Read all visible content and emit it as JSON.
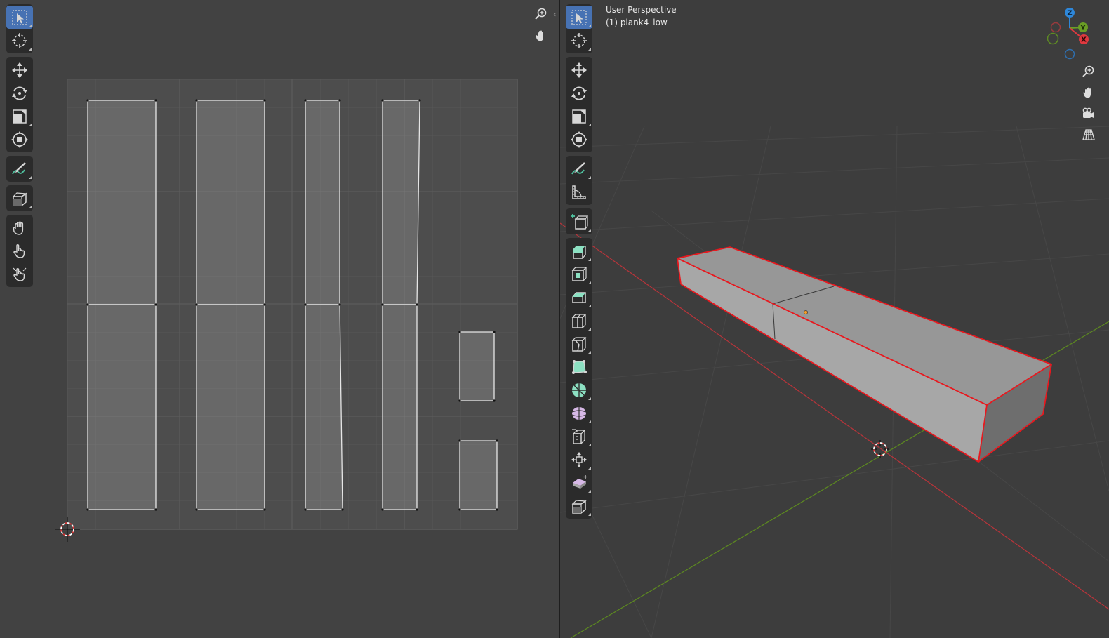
{
  "uv_editor": {
    "tools": [
      {
        "group": 1,
        "name": "select-box-tool",
        "icon": "cursor-select-icon",
        "active": true
      },
      {
        "group": 1,
        "name": "cursor-tool",
        "icon": "cursor-crosshair-icon",
        "active": false
      },
      {
        "group": 2,
        "name": "move-tool",
        "icon": "move-icon",
        "active": false
      },
      {
        "group": 2,
        "name": "rotate-tool",
        "icon": "rotate-icon",
        "active": false
      },
      {
        "group": 2,
        "name": "scale-tool",
        "icon": "scale-icon",
        "active": false
      },
      {
        "group": 2,
        "name": "transform-tool",
        "icon": "transform-icon",
        "active": false
      },
      {
        "group": 3,
        "name": "annotate-tool",
        "icon": "annotate-icon",
        "active": false
      },
      {
        "group": 4,
        "name": "rip-tool",
        "icon": "rip-region-icon",
        "active": false
      },
      {
        "group": 5,
        "name": "grab-tool",
        "icon": "grab-hand-icon",
        "active": false
      },
      {
        "group": 5,
        "name": "relax-tool",
        "icon": "relax-hand-icon",
        "active": false
      },
      {
        "group": 5,
        "name": "pinch-tool",
        "icon": "pinch-hand-icon",
        "active": false
      }
    ],
    "nav_icons": [
      "zoom-icon",
      "pan-hand-icon"
    ]
  },
  "viewport": {
    "view_name": "User Perspective",
    "object_name": "(1) plank4_low",
    "gizmo_axes": [
      "X",
      "Y",
      "Z"
    ],
    "axis_colors": {
      "x": "#e0393f",
      "y": "#6a9e25",
      "z": "#2e87d9"
    },
    "selection_color": "#e8181e",
    "tools": [
      {
        "group": 1,
        "name": "select-box-tool",
        "icon": "cursor-select-icon",
        "active": true
      },
      {
        "group": 1,
        "name": "cursor-tool",
        "icon": "cursor-crosshair-icon",
        "active": false
      },
      {
        "group": 2,
        "name": "move-tool",
        "icon": "move-icon",
        "active": false
      },
      {
        "group": 2,
        "name": "rotate-tool",
        "icon": "rotate-icon",
        "active": false
      },
      {
        "group": 2,
        "name": "scale-tool",
        "icon": "scale-icon",
        "active": false
      },
      {
        "group": 2,
        "name": "transform-tool",
        "icon": "transform-icon",
        "active": false
      },
      {
        "group": 3,
        "name": "annotate-tool",
        "icon": "annotate-icon",
        "active": false
      },
      {
        "group": 3,
        "name": "measure-tool",
        "icon": "measure-icon",
        "active": false
      },
      {
        "group": 4,
        "name": "add-cube-tool",
        "icon": "add-cube-icon",
        "active": false
      },
      {
        "group": 5,
        "name": "extrude-tool",
        "icon": "extrude-icon",
        "active": false
      },
      {
        "group": 5,
        "name": "inset-tool",
        "icon": "inset-icon",
        "active": false
      },
      {
        "group": 5,
        "name": "bevel-tool",
        "icon": "bevel-icon",
        "active": false
      },
      {
        "group": 5,
        "name": "loop-cut-tool",
        "icon": "loop-cut-icon",
        "active": false
      },
      {
        "group": 5,
        "name": "knife-tool",
        "icon": "knife-icon",
        "active": false
      },
      {
        "group": 5,
        "name": "poly-build-tool",
        "icon": "poly-build-icon",
        "active": false
      },
      {
        "group": 5,
        "name": "spin-tool",
        "icon": "spin-icon",
        "active": false
      },
      {
        "group": 5,
        "name": "smooth-tool",
        "icon": "smooth-icon",
        "active": false
      },
      {
        "group": 5,
        "name": "edge-slide-tool",
        "icon": "edge-slide-icon",
        "active": false
      },
      {
        "group": 5,
        "name": "shrink-fatten-tool",
        "icon": "shrink-fatten-icon",
        "active": false
      },
      {
        "group": 5,
        "name": "shear-tool",
        "icon": "shear-icon",
        "active": false
      },
      {
        "group": 5,
        "name": "rip-tool",
        "icon": "rip-region-icon",
        "active": false
      }
    ],
    "nav_icons": [
      "zoom-icon",
      "pan-hand-icon",
      "camera-icon",
      "perspective-grid-icon"
    ]
  }
}
